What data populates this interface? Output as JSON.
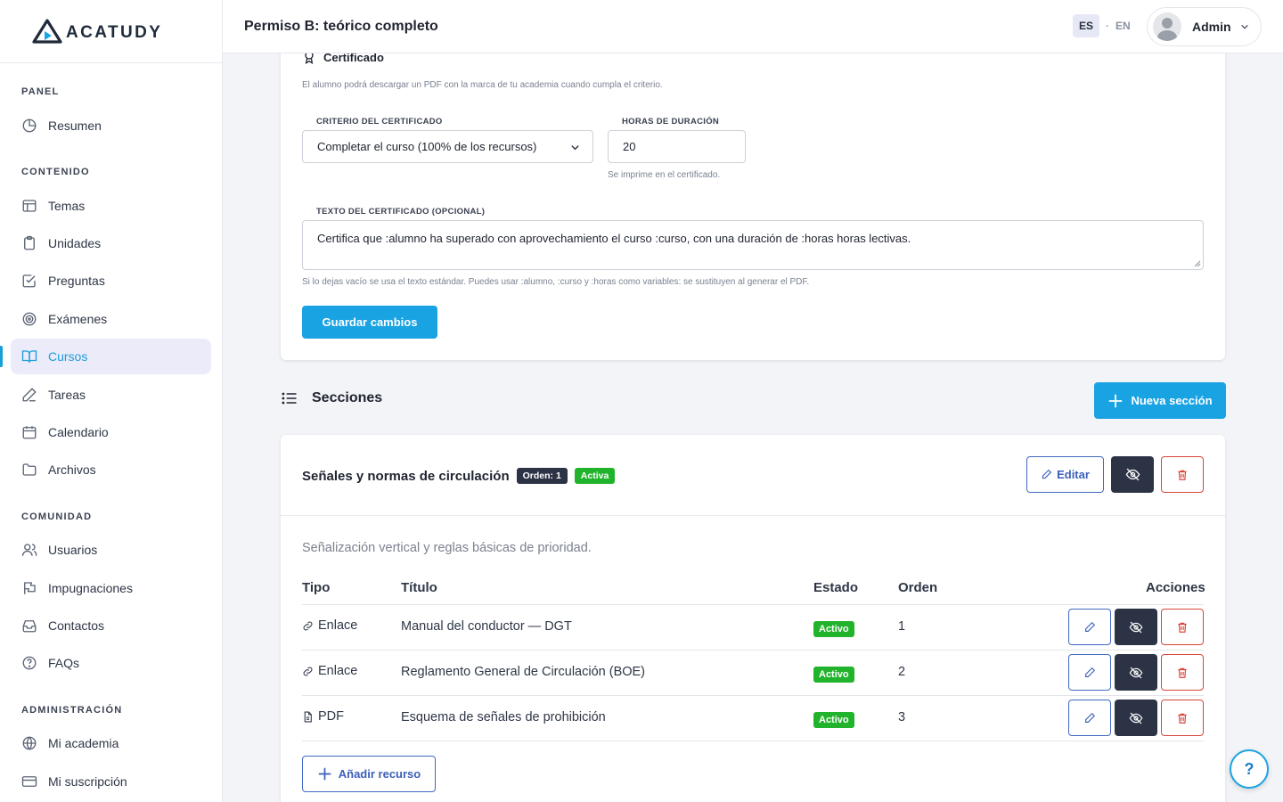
{
  "app": {
    "name": "ACATUDY"
  },
  "sidebar": {
    "sections": [
      {
        "title": "PANEL"
      },
      {
        "title": "CONTENIDO"
      },
      {
        "title": "COMUNIDAD"
      },
      {
        "title": "ADMINISTRACIÓN"
      }
    ],
    "items": [
      {
        "label": "Resumen",
        "icon": "pie-chart-icon"
      },
      {
        "label": "Temas",
        "icon": "layout-icon"
      },
      {
        "label": "Unidades",
        "icon": "clipboard-icon"
      },
      {
        "label": "Preguntas",
        "icon": "check-square-icon"
      },
      {
        "label": "Exámenes",
        "icon": "target-icon"
      },
      {
        "label": "Cursos",
        "icon": "book-open-icon",
        "active": true
      },
      {
        "label": "Tareas",
        "icon": "pen-icon"
      },
      {
        "label": "Calendario",
        "icon": "calendar-icon"
      },
      {
        "label": "Archivos",
        "icon": "folder-icon"
      },
      {
        "label": "Usuarios",
        "icon": "users-icon"
      },
      {
        "label": "Impugnaciones",
        "icon": "flag-icon"
      },
      {
        "label": "Contactos",
        "icon": "inbox-icon"
      },
      {
        "label": "FAQs",
        "icon": "help-circle-icon"
      },
      {
        "label": "Mi academia",
        "icon": "globe-icon"
      },
      {
        "label": "Mi suscripción",
        "icon": "credit-card-icon"
      }
    ]
  },
  "topbar": {
    "title": "Permiso B: teórico completo",
    "lang_es": "ES",
    "lang_sep": "·",
    "lang_en": "EN",
    "user_name": "Admin"
  },
  "certificate": {
    "heading": "Certificado",
    "description": "El alumno podrá descargar un PDF con la marca de tu academia cuando cumpla el criterio.",
    "criterion_label": "CRITERIO DEL CERTIFICADO",
    "criterion_value": "Completar el curso (100% de los recursos)",
    "hours_label": "HORAS DE DURACIÓN",
    "hours_value": "20",
    "hours_hint": "Se imprime en el certificado.",
    "text_label": "TEXTO DEL CERTIFICADO (OPCIONAL)",
    "text_value": "Certifica que :alumno ha superado con aprovechamiento el curso :curso, con una duración de :horas horas lectivas.",
    "text_hint": "Si lo dejas vacío se usa el texto estándar. Puedes usar :alumno, :curso y :horas como variables: se sustituyen al generar el PDF.",
    "save_label": "Guardar cambios"
  },
  "sections": {
    "heading": "Secciones",
    "new_label": "Nueva sección",
    "items": [
      {
        "title": "Señales y normas de circulación",
        "order_badge": "Orden: 1",
        "status_badge": "Activa",
        "edit_label": "Editar",
        "description": "Señalización vertical y reglas básicas de prioridad.",
        "columns": [
          "Tipo",
          "Título",
          "Estado",
          "Orden",
          "Acciones"
        ],
        "resources": [
          {
            "type": "Enlace",
            "type_icon": "link-icon",
            "title": "Manual del conductor — DGT",
            "status": "Activo",
            "order": "1"
          },
          {
            "type": "Enlace",
            "type_icon": "link-icon",
            "title": "Reglamento General de Circulación (BOE)",
            "status": "Activo",
            "order": "2"
          },
          {
            "type": "PDF",
            "type_icon": "file-icon",
            "title": "Esquema de señales de prohibición",
            "status": "Activo",
            "order": "3"
          }
        ],
        "add_resource_label": "Añadir recurso"
      }
    ]
  },
  "help": {
    "label": "?"
  },
  "colors": {
    "accent": "#1aa3e3",
    "dark": "#2c3345",
    "success": "#22b32c",
    "danger": "#d9453a",
    "outline_blue": "#4168c2"
  }
}
